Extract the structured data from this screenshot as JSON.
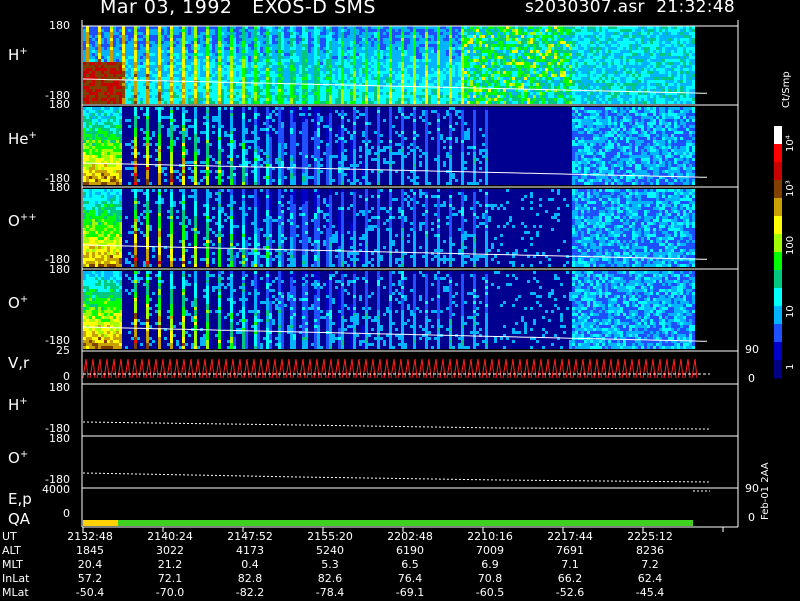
{
  "header": {
    "title": "Mar 03, 1992   EXOS-D SMS",
    "file_info": "s2030307.asr  21:32:48"
  },
  "panels": [
    {
      "label": "H",
      "sup": "+",
      "top_tick": "180",
      "bottom_tick": "-180"
    },
    {
      "label": "He",
      "sup": "+",
      "top_tick": "180",
      "bottom_tick": "-180"
    },
    {
      "label": "O",
      "sup": "++",
      "top_tick": "180",
      "bottom_tick": "-180"
    },
    {
      "label": "O",
      "sup": "+",
      "top_tick": "180",
      "bottom_tick": "-180"
    }
  ],
  "vr_panel": {
    "label": "V,r",
    "top_tick": "25",
    "bottom_tick": "0",
    "right_top": "90",
    "right_bottom": "0"
  },
  "h_line_panel": {
    "label": "H",
    "sup": "+",
    "top_tick": "180",
    "bottom_tick": "-180"
  },
  "o_line_panel": {
    "label": "O",
    "sup": "+",
    "top_tick": "180",
    "bottom_tick": "-180"
  },
  "ep_panel": {
    "label": "E,p",
    "top_tick": "4000",
    "bottom_tick": "0",
    "right_top": "90",
    "right_bottom": "0"
  },
  "qa_panel": {
    "label": "QA"
  },
  "colorbar": {
    "unit": "Ct/Smp",
    "ticks": [
      "10⁴",
      "10³",
      "100",
      "10",
      "1"
    ]
  },
  "table": {
    "rows": [
      {
        "name": "UT",
        "values": [
          "2132:48",
          "2140:24",
          "2147:52",
          "2155:20",
          "2202:48",
          "2210:16",
          "2217:44",
          "2225:12"
        ]
      },
      {
        "name": "ALT",
        "values": [
          "1845",
          "3022",
          "4173",
          "5240",
          "6190",
          "7009",
          "7691",
          "8236"
        ]
      },
      {
        "name": "MLT",
        "values": [
          "20.4",
          "21.2",
          "0.4",
          "5.3",
          "6.5",
          "6.9",
          "7.1",
          "7.2"
        ]
      },
      {
        "name": "InLat",
        "values": [
          "57.2",
          "72.1",
          "82.8",
          "82.6",
          "76.4",
          "70.8",
          "66.2",
          "62.4"
        ]
      },
      {
        "name": "MLat",
        "values": [
          "-50.4",
          "-70.0",
          "-82.2",
          "-78.4",
          "-69.1",
          "-60.5",
          "-52.6",
          "-45.4"
        ]
      }
    ]
  },
  "footer": "Feb-01 2AA",
  "chart_data": {
    "type": "heatmap",
    "title": "Mar 03, 1992   EXOS-D SMS",
    "x": [
      "2132:48",
      "2140:24",
      "2147:52",
      "2155:20",
      "2202:48",
      "2210:16",
      "2217:44",
      "2225:12"
    ],
    "series": [
      {
        "name": "H+"
      },
      {
        "name": "He+"
      },
      {
        "name": "O++"
      },
      {
        "name": "O+"
      }
    ],
    "ylim": [
      -180,
      180
    ],
    "colorbar_ticks": [
      1,
      10,
      100,
      1000,
      10000
    ],
    "colorbar_scale": "log",
    "colorbar_label": "Ct/Smp",
    "colors": [
      "#000080",
      "#0000c8",
      "#1e50ff",
      "#00b4ff",
      "#00ffff",
      "#00c880",
      "#00ff00",
      "#a0ff00",
      "#ffff00",
      "#c8a000",
      "#804000",
      "#c80000",
      "#ff0000",
      "#ffffff"
    ]
  }
}
